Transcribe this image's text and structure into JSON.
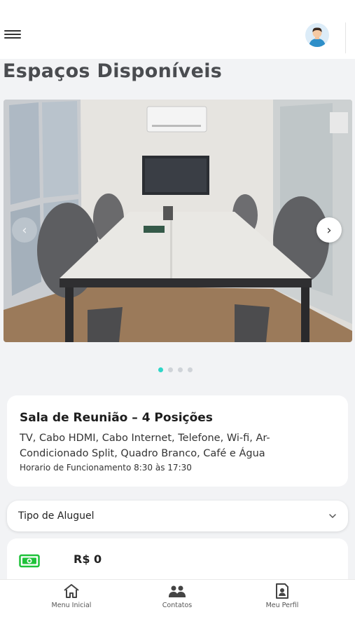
{
  "header": {
    "menu_icon": "hamburger-menu-icon",
    "avatar_icon": "user-avatar-icon"
  },
  "page": {
    "title": "Espaços Disponíveis"
  },
  "carousel": {
    "image_description": "meeting-room-photo",
    "prev_icon": "chevron-left-icon",
    "next_icon": "chevron-right-icon",
    "prev_glyph": "‹",
    "next_glyph": "›",
    "slide_count": 4,
    "active_slide": 1,
    "accent_color": "#2fd6c8"
  },
  "room": {
    "title": "Sala de Reunião – 4 Posições",
    "description": "TV, Cabo HDMI, Cabo Internet, Telefone, Wi-fi, Ar-Condicionado Split, Quadro Branco, Café e Água",
    "hours": "Horario de Funcionamento 8:30 às 17:30"
  },
  "rental": {
    "label": "Tipo de Aluguel",
    "icon": "chevron-down-icon"
  },
  "price": {
    "icon": "money-bill-icon",
    "value": "R$ 0",
    "icon_color": "#1fc23a"
  },
  "bottom_nav": {
    "items": [
      {
        "label": "Menu Inicial",
        "icon": "home-icon"
      },
      {
        "label": "Contatos",
        "icon": "contacts-icon"
      },
      {
        "label": "Meu Perfil",
        "icon": "profile-icon"
      }
    ]
  }
}
